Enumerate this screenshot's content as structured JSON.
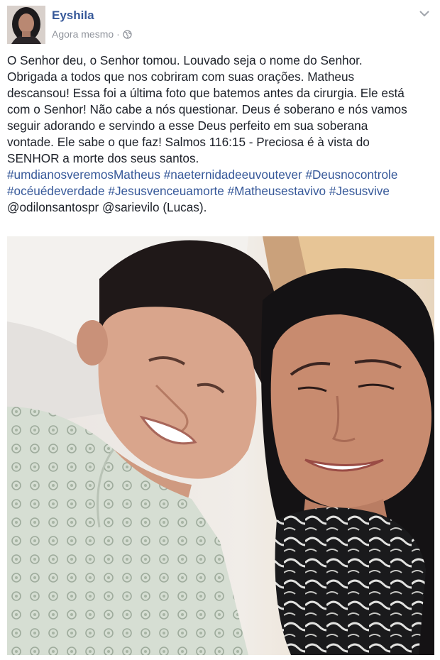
{
  "post": {
    "author": "Eyshila",
    "timestamp": "Agora mesmo",
    "separator": "·",
    "privacy_icon": "globe-icon",
    "menu_icon": "chevron-down-icon",
    "text_lines": [
      "O Senhor deu, o Senhor tomou. Louvado seja o nome do Senhor.",
      "Obrigada a todos que nos cobriram com suas orações. Matheus",
      "descansou! Essa foi a última foto que batemos antes da cirurgia. Ele está",
      "com o Senhor! Não cabe a nós questionar. Deus é soberano e nós vamos",
      "seguir adorando e servindo a esse Deus perfeito em sua soberana",
      "vontade. Ele sabe o que faz! Salmos 116:15 - Preciosa é à vista do",
      "SENHOR a morte dos seus santos."
    ],
    "hashtags_line1": [
      "#umdianosveremosMatheus",
      "#naeternidadeeuvoutever",
      "#Deusnocontrole"
    ],
    "hashtags_line2": [
      "#océuédeverdade",
      "#Jesusvenceuamorte",
      "#Matheusestavivo",
      "#Jesusvive"
    ],
    "mentions": [
      "@odilonsantospr",
      "@sarievilo"
    ],
    "mention_suffix": "(Lucas).",
    "colors": {
      "link": "#365899",
      "text": "#1d2129",
      "meta": "#90949c"
    }
  }
}
